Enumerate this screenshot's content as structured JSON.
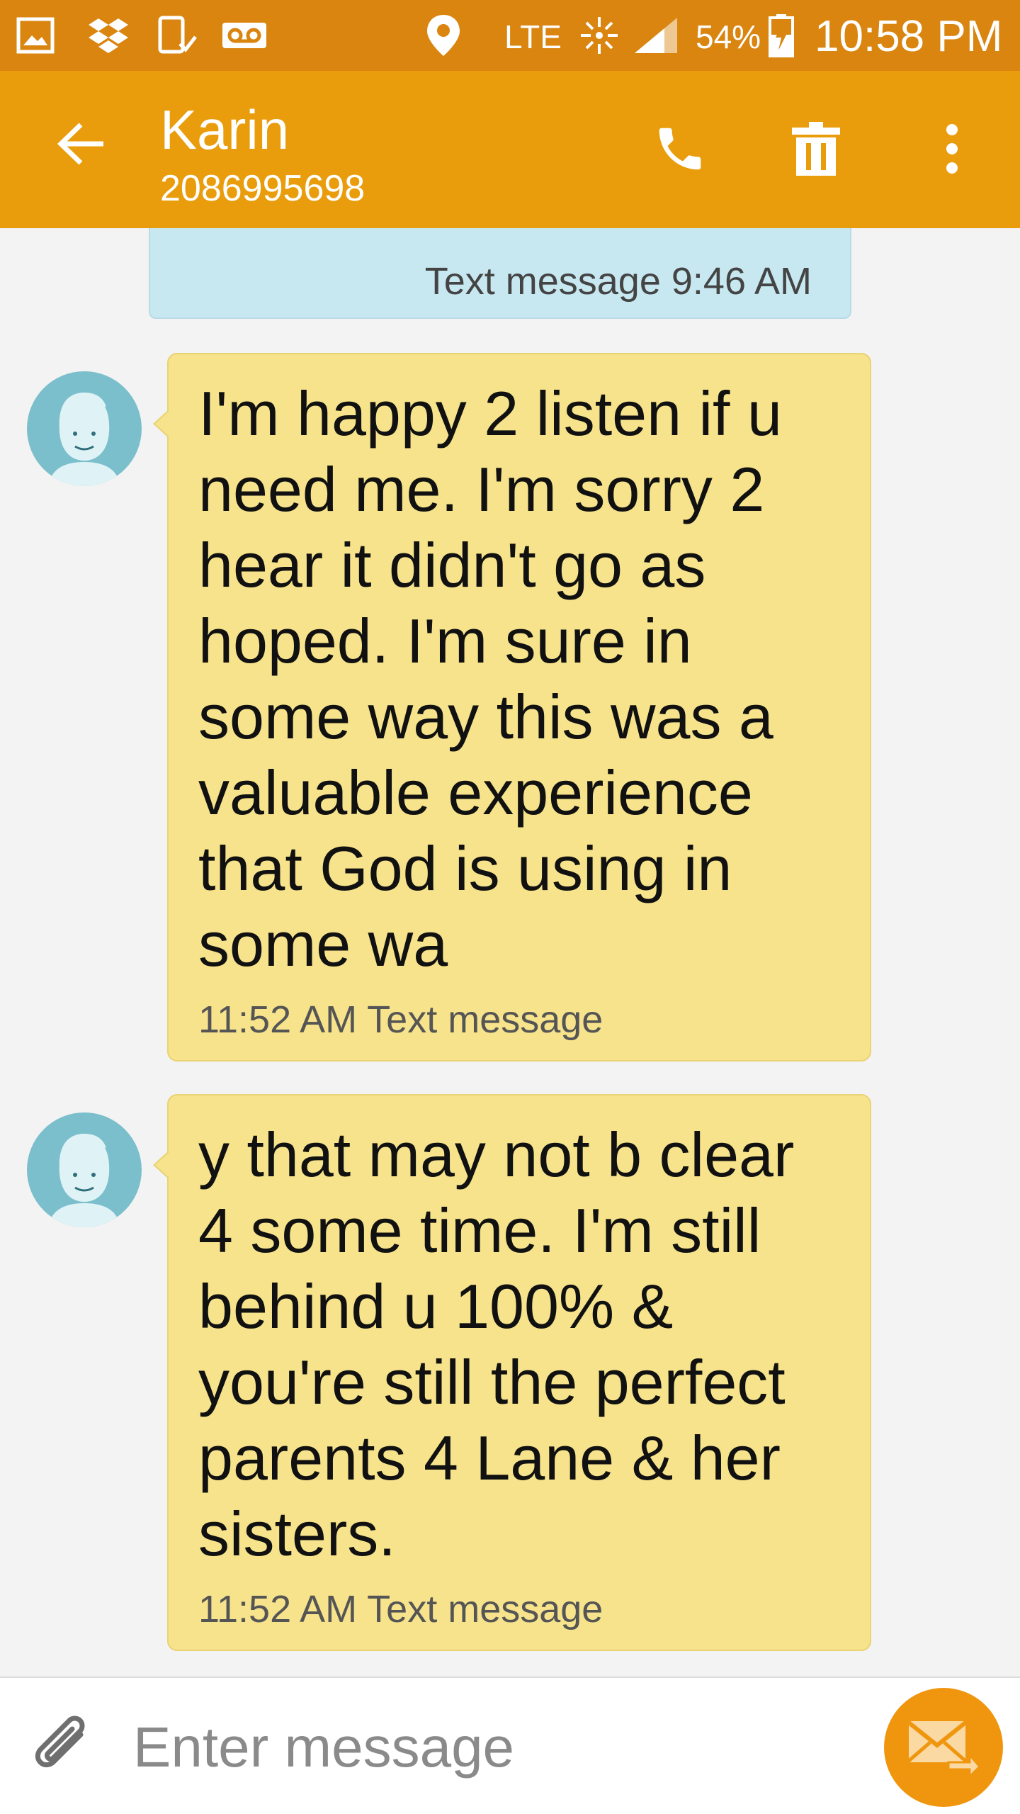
{
  "status_bar": {
    "network": "LTE",
    "battery": "54%",
    "time": "10:58 PM",
    "icons": [
      "gallery-icon",
      "dropbox-icon",
      "device-check-icon",
      "voicemail-icon",
      "location-icon",
      "data-activity-icon",
      "signal-icon",
      "battery-charging-icon"
    ]
  },
  "app_bar": {
    "back_icon": "arrow-left-icon",
    "contact_name": "Karin",
    "contact_number": "2086995698",
    "actions": [
      "phone-icon",
      "trash-icon",
      "more-vert-icon"
    ]
  },
  "thread": {
    "sent": {
      "meta": "Text message 9:46 AM"
    },
    "messages": [
      {
        "text": "I'm happy 2 listen if u need me. I'm sorry 2 hear it didn't go as hoped. I'm sure in some way this was a valuable experience that God is using in some wa",
        "meta": "11:52 AM Text message"
      },
      {
        "text": "y that may not b clear 4 some time. I'm still behind u 100% & you're still the perfect parents 4 Lane & her sisters.",
        "meta": "11:52 AM Text message"
      }
    ]
  },
  "composer": {
    "placeholder": "Enter message",
    "value": "",
    "attach_icon": "paperclip-icon",
    "send_icon": "send-envelope-icon"
  },
  "colors": {
    "status_bar": "#d9850f",
    "app_bar": "#e99d0c",
    "received_bubble": "#f6e38b",
    "sent_bubble": "#c8e8f1",
    "send_button": "#f0960e",
    "avatar": "#7bbfcc"
  }
}
